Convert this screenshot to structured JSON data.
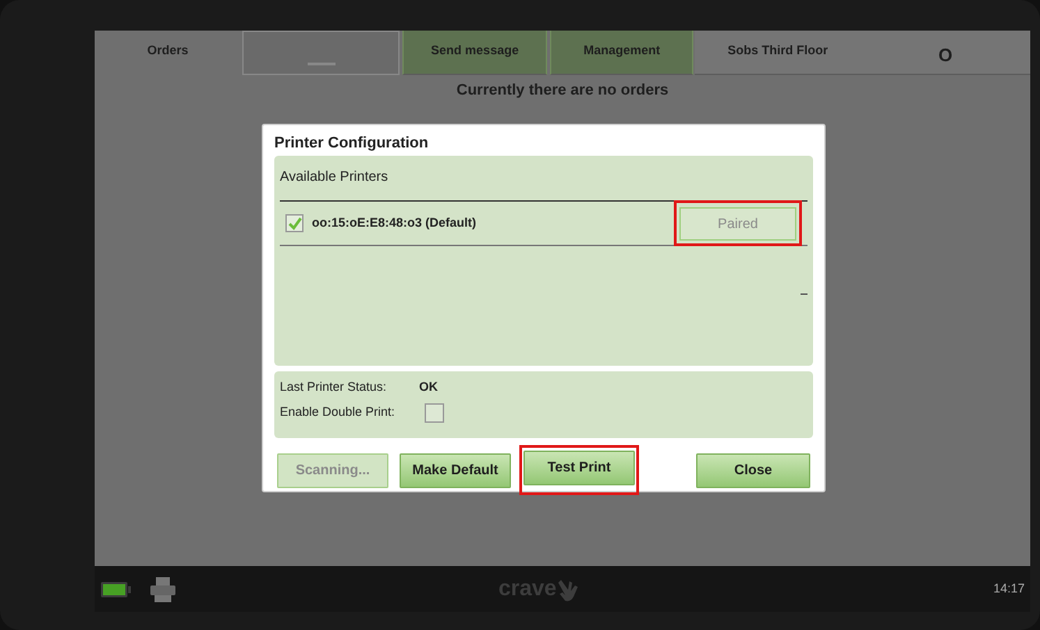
{
  "tabs": [
    {
      "kind": "plain",
      "label": "Orders",
      "selected": true
    },
    {
      "kind": "blank",
      "selected": false
    },
    {
      "kind": "green",
      "label": "Send message",
      "selected": false
    },
    {
      "kind": "green",
      "label": "Management",
      "selected": false
    },
    {
      "kind": "plain",
      "label": "Sobs Third Floor",
      "selected": false
    },
    {
      "kind": "plain",
      "label": "O",
      "selected": false
    }
  ],
  "message": "Currently there are no orders",
  "dialog": {
    "title": "Printer Configuration",
    "printers_header": "Available Printers",
    "printers": [
      {
        "name": "oo:15:oE:E8:48:o3 (Default)",
        "checked": true,
        "action": "Paired",
        "action_disabled": true,
        "highlighted": true
      }
    ],
    "status_label": "Last Printer Status:",
    "status_value": "OK",
    "double_print_label": "Enable Double Print:",
    "double_print_checked": false,
    "buttons": [
      {
        "label": "Scanning...",
        "disabled": true,
        "highlighted": false
      },
      {
        "label": "Make Default",
        "disabled": false,
        "highlighted": false
      },
      {
        "label": "Test Print",
        "disabled": false,
        "highlighted": true
      },
      {
        "label": "Close",
        "disabled": false,
        "highlighted": false
      }
    ]
  },
  "status_bar": {
    "logo": "crave",
    "time": "14:17"
  }
}
